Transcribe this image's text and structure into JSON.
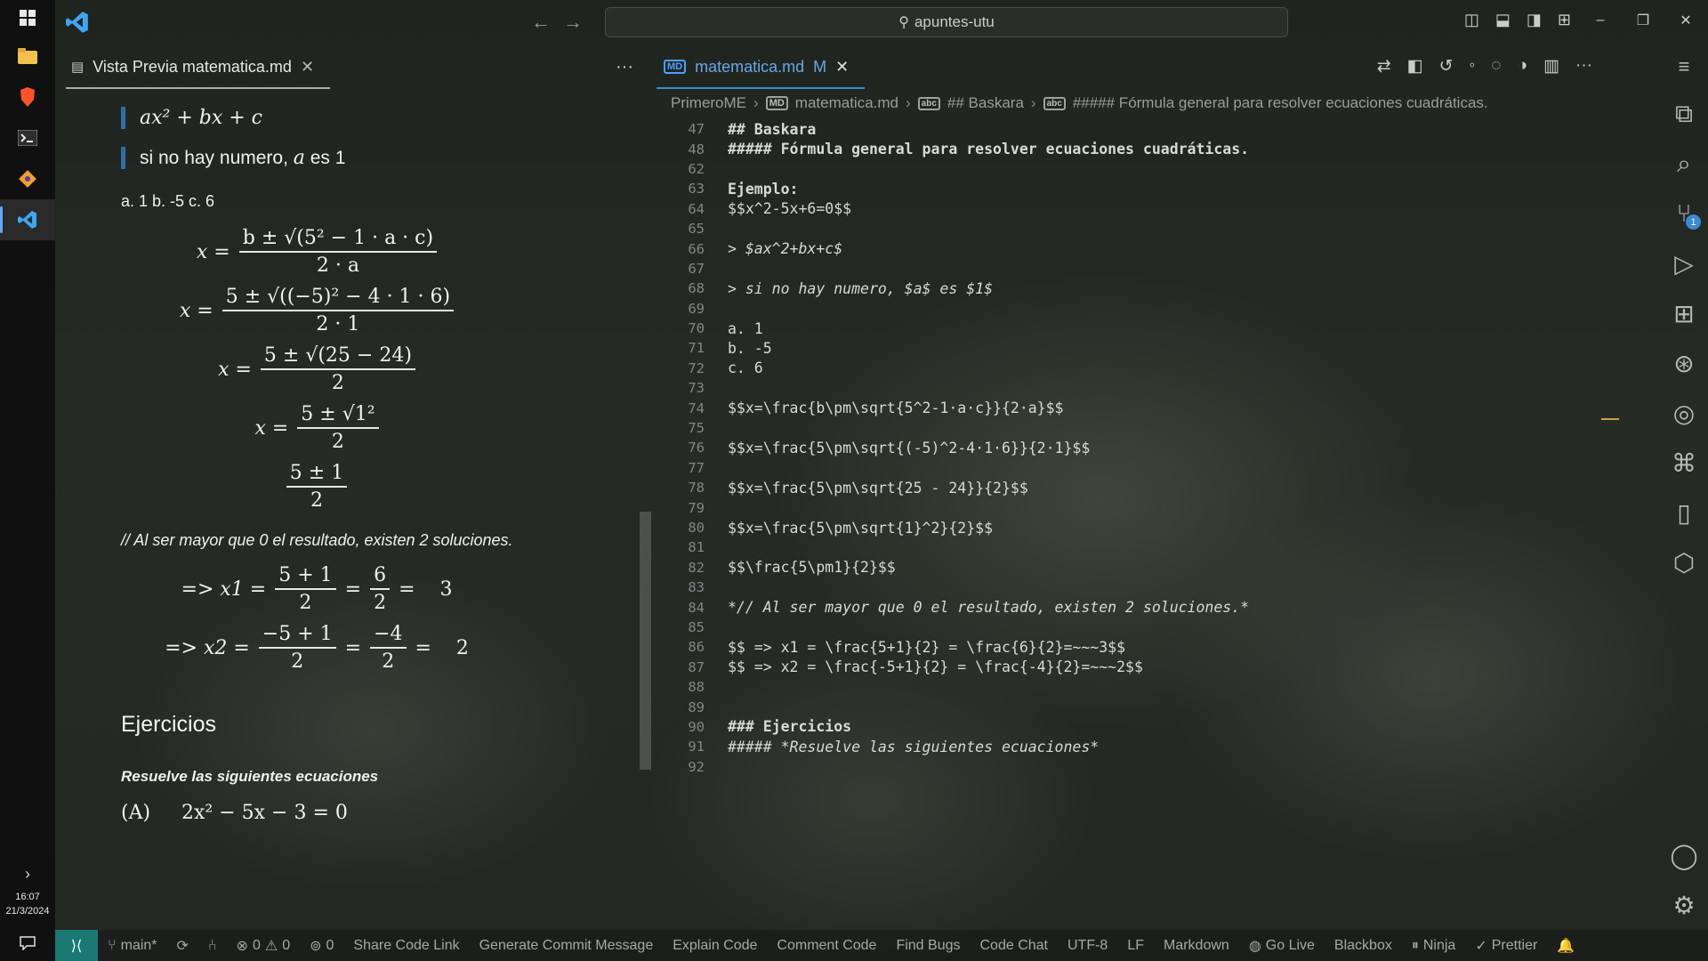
{
  "window": {
    "search_text": "apuntes-utu"
  },
  "taskbar": {
    "time": "16:07",
    "date": "21/3/2024"
  },
  "preview_tab": {
    "label": "Vista Previa matematica.md"
  },
  "editor_tab": {
    "label": "matematica.md",
    "badge": "MD",
    "modified": "M"
  },
  "breadcrumb": {
    "items": [
      "PrimeroME",
      "matematica.md",
      "## Baskara",
      "##### Fórmula general para resolver ecuaciones cuadráticas."
    ]
  },
  "preview": {
    "quote1": "ax² + bx + c",
    "quote2_pre": "si no hay numero, ",
    "quote2_var": "a",
    "quote2_mid": " es ",
    "quote2_num": "1",
    "list": "a. 1 b. -5 c. 6",
    "eq1_lhs": "x =",
    "eq1_num": "b ± √(5² − 1 · a · c)",
    "eq1_den": "2 · a",
    "eq2_lhs": "x =",
    "eq2_num": "5 ± √((−5)² − 4 · 1 · 6)",
    "eq2_den": "2 · 1",
    "eq3_lhs": "x =",
    "eq3_num": "5 ± √(25 − 24)",
    "eq3_den": "2",
    "eq4_lhs": "x =",
    "eq4_num": "5 ± √1²",
    "eq4_den": "2",
    "eq5_num": "5 ± 1",
    "eq5_den": "2",
    "note": "// Al ser mayor que 0 el resultado, existen 2 soluciones.",
    "sol1_lhs": "=> x1 =",
    "sol1_n1": "5 + 1",
    "sol1_d1": "2",
    "sol1_eq": "=",
    "sol1_n2": "6",
    "sol1_d2": "2",
    "sol1_res": "=    3",
    "sol2_lhs": "=> x2 =",
    "sol2_n1": "−5 + 1",
    "sol2_d1": "2",
    "sol2_eq": "=",
    "sol2_n2": "−4",
    "sol2_d2": "2",
    "sol2_res": "=    2",
    "heading": "Ejercicios",
    "subheading": "Resuelve las siguientes ecuaciones",
    "exercise": "(A)     2x² − 5x − 3 = 0"
  },
  "code_lines": [
    {
      "n": "47",
      "t": "## Baskara",
      "c": "c-head"
    },
    {
      "n": "48",
      "t": "##### Fórmula general para resolver ecuaciones cuadráticas.",
      "c": "c-head"
    },
    {
      "n": "62",
      "t": "",
      "c": "c-plain"
    },
    {
      "n": "63",
      "t": "Ejemplo:",
      "c": "c-bold"
    },
    {
      "n": "64",
      "t": "$$x^2-5x+6=0$$",
      "c": "c-plain"
    },
    {
      "n": "65",
      "t": "",
      "c": "c-plain"
    },
    {
      "n": "66",
      "t": "> $ax^2+bx+c$",
      "c": "c-bq"
    },
    {
      "n": "67",
      "t": "",
      "c": "c-plain"
    },
    {
      "n": "68",
      "t": "> si no hay numero, $a$ es $1$",
      "c": "c-bq"
    },
    {
      "n": "69",
      "t": "",
      "c": "c-plain"
    },
    {
      "n": "70",
      "t": "a. 1",
      "c": "c-plain"
    },
    {
      "n": "71",
      "t": "b. -5",
      "c": "c-plain"
    },
    {
      "n": "72",
      "t": "c. 6",
      "c": "c-plain"
    },
    {
      "n": "73",
      "t": "",
      "c": "c-plain"
    },
    {
      "n": "74",
      "t": "$$x=\\frac{b\\pm\\sqrt{5^2-1·a·c}}{2·a}$$",
      "c": "c-plain"
    },
    {
      "n": "75",
      "t": "",
      "c": "c-plain"
    },
    {
      "n": "76",
      "t": "$$x=\\frac{5\\pm\\sqrt{(-5)^2-4·1·6}}{2·1}$$",
      "c": "c-plain"
    },
    {
      "n": "77",
      "t": "",
      "c": "c-plain"
    },
    {
      "n": "78",
      "t": "$$x=\\frac{5\\pm\\sqrt{25 - 24}}{2}$$",
      "c": "c-plain"
    },
    {
      "n": "79",
      "t": "",
      "c": "c-plain"
    },
    {
      "n": "80",
      "t": "$$x=\\frac{5\\pm\\sqrt{1}^2}{2}$$",
      "c": "c-plain"
    },
    {
      "n": "81",
      "t": "",
      "c": "c-plain"
    },
    {
      "n": "82",
      "t": "$$\\frac{5\\pm1}{2}$$",
      "c": "c-plain"
    },
    {
      "n": "83",
      "t": "",
      "c": "c-plain"
    },
    {
      "n": "84",
      "t": "*// Al ser mayor que 0 el resultado, existen 2 soluciones.*",
      "c": "c-em"
    },
    {
      "n": "85",
      "t": "",
      "c": "c-plain"
    },
    {
      "n": "86",
      "t": "$$ => x1 = \\frac{5+1}{2} = \\frac{6}{2}=~~~3$$",
      "c": "c-plain"
    },
    {
      "n": "87",
      "t": "$$ => x2 = \\frac{-5+1}{2} = \\frac{-4}{2}=~~~2$$",
      "c": "c-plain"
    },
    {
      "n": "88",
      "t": "",
      "c": "c-plain"
    },
    {
      "n": "89",
      "t": "",
      "c": "c-plain"
    },
    {
      "n": "90",
      "t": "### Ejercicios",
      "c": "c-head"
    },
    {
      "n": "91",
      "t": "##### *Resuelve las siguientes ecuaciones*",
      "c": "c-em"
    },
    {
      "n": "92",
      "t": "",
      "c": "c-plain"
    }
  ],
  "statusbar": {
    "remote": "⟩⟨",
    "branch": "main*",
    "errors": "0",
    "warnings": "0",
    "ports": "0",
    "items": [
      "Share Code Link",
      "Generate Commit Message",
      "Explain Code",
      "Comment Code",
      "Find Bugs",
      "Code Chat"
    ],
    "encoding": "UTF-8",
    "eol": "LF",
    "language": "Markdown",
    "go_live": "Go Live",
    "blackbox": "Blackbox",
    "ninja": "Ninja",
    "prettier": "Prettier"
  }
}
